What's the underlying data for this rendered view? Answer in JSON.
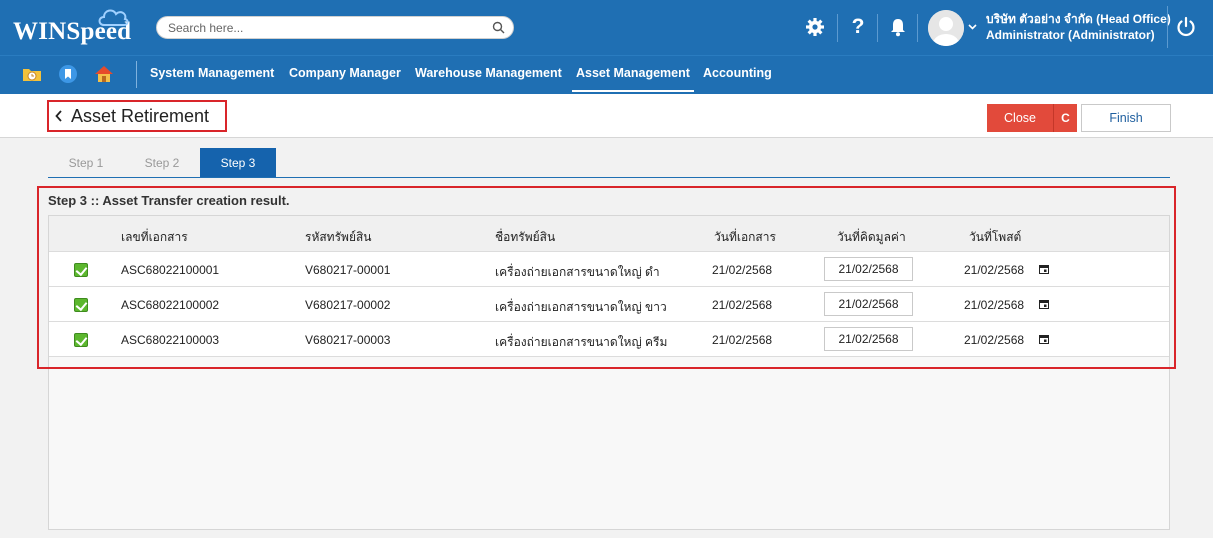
{
  "header": {
    "brand": "WINSpeed",
    "search_placeholder": "Search here...",
    "company": "บริษัท ตัวอย่าง จำกัด (Head Office)",
    "user": "Administrator (Administrator)",
    "brand_color": "#1f6fb3"
  },
  "nav": {
    "items": [
      "System Management",
      "Company Manager",
      "Warehouse Management",
      "Asset Management",
      "Accounting"
    ],
    "active": "Asset Management"
  },
  "page": {
    "title": "Asset Retirement",
    "close_label": "Close",
    "close_key": "C",
    "finish_label": "Finish"
  },
  "steps": {
    "items": [
      "Step 1",
      "Step 2",
      "Step 3"
    ],
    "active_index": 2
  },
  "result": {
    "title": "Step 3 :: Asset Transfer creation result.",
    "columns": [
      "เลขที่เอกสาร",
      "รหัสทรัพย์สิน",
      "ชื่อทรัพย์สิน",
      "วันที่เอกสาร",
      "วันที่คิดมูลค่า",
      "วันที่โพสต์"
    ],
    "rows": [
      {
        "doc_no": "ASC68022100001",
        "asset_code": "V680217-00001",
        "asset_name": "เครื่องถ่ายเอกสารขนาดใหญ่ ดำ",
        "doc_date": "21/02/2568",
        "value_date": "21/02/2568",
        "post_date": "21/02/2568"
      },
      {
        "doc_no": "ASC68022100002",
        "asset_code": "V680217-00002",
        "asset_name": "เครื่องถ่ายเอกสารขนาดใหญ่ ขาว",
        "doc_date": "21/02/2568",
        "value_date": "21/02/2568",
        "post_date": "21/02/2568"
      },
      {
        "doc_no": "ASC68022100003",
        "asset_code": "V680217-00003",
        "asset_name": "เครื่องถ่ายเอกสารขนาดใหญ่ ครีม",
        "doc_date": "21/02/2568",
        "value_date": "21/02/2568",
        "post_date": "21/02/2568"
      }
    ]
  }
}
